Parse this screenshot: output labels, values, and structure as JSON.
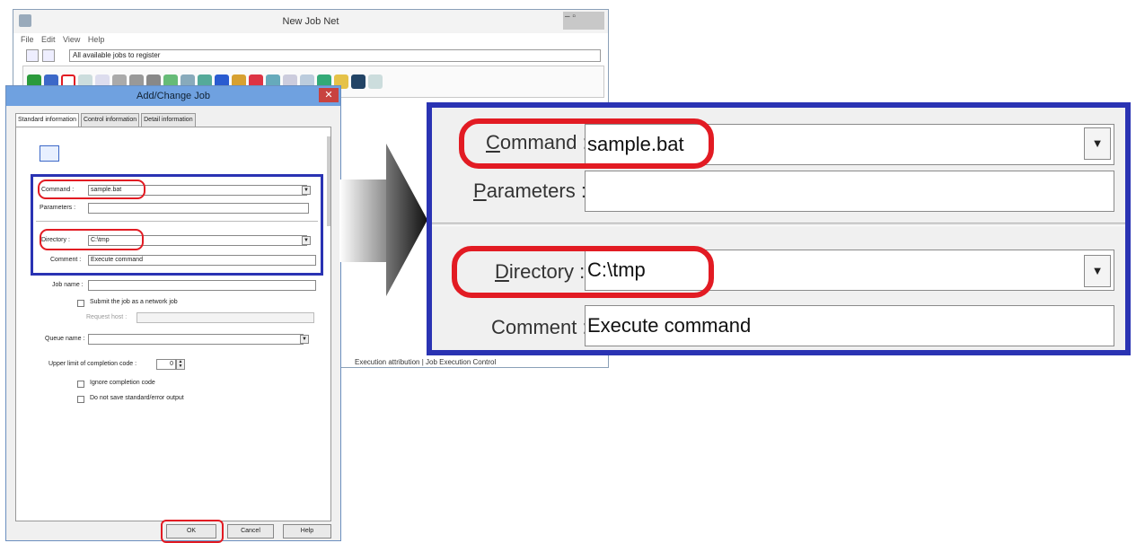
{
  "back_window": {
    "title": "New Job Net",
    "menu": "File Edit View Help",
    "combo": "All available jobs to register",
    "status": "Execution attribution | Job Execution Control"
  },
  "dialog": {
    "title": "Add/Change Job",
    "tabs": [
      "Standard information",
      "Control information",
      "Detail information"
    ],
    "command_label": "Command :",
    "command_value": "sample.bat",
    "parameters_label": "Parameters :",
    "parameters_value": "",
    "directory_label": "Directory :",
    "directory_value": "C:\\tmp",
    "comment_label": "Comment :",
    "comment_value": "Execute command",
    "job_name_label": "Job name :",
    "job_name_value": "",
    "network_job_label": "Submit the job as a network job",
    "request_host_label": "Request host :",
    "queue_name_label": "Queue name :",
    "completion_code_label": "Upper limit of completion code :",
    "completion_code_value": "0",
    "ignore_completion_label": "Ignore completion code",
    "no_save_output_label": "Do not save standard/error output",
    "ok_label": "OK",
    "cancel_label": "Cancel",
    "help_label": "Help"
  },
  "zoom": {
    "command_label": "Command :",
    "command_value": "sample.bat",
    "parameters_label": "Parameters :",
    "parameters_value": "",
    "directory_label": "Directory :",
    "directory_value": "C:\\tmp",
    "comment_label": "Comment :",
    "comment_value": "Execute command"
  },
  "colors": {
    "highlight_red": "#e21b23",
    "highlight_blue": "#2a33b3",
    "title_bar": "#6fa1e0"
  }
}
